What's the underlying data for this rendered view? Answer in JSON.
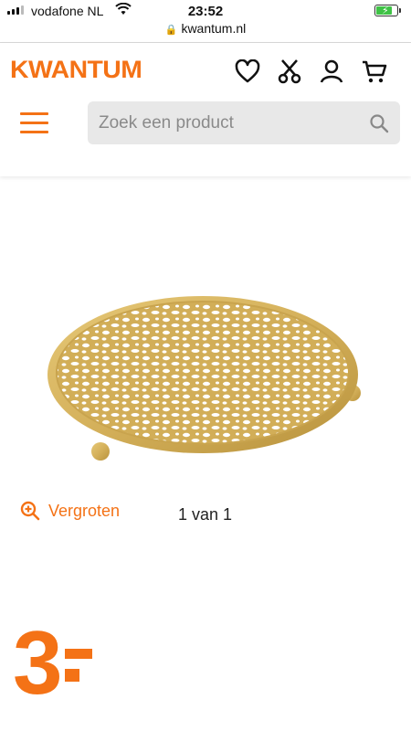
{
  "status_bar": {
    "carrier": "vodafone NL",
    "time": "23:52",
    "battery_color": "#3fc246"
  },
  "browser": {
    "url": "kwantum.nl"
  },
  "header": {
    "logo_text": "KWANTUM",
    "brand_color": "#f47216",
    "icons": [
      "heart-icon",
      "scissors-icon",
      "user-icon",
      "cart-icon"
    ],
    "search_placeholder": "Zoek een product"
  },
  "product": {
    "zoom_label": "Vergroten",
    "pager": "1 van 1",
    "price_int": "3"
  }
}
